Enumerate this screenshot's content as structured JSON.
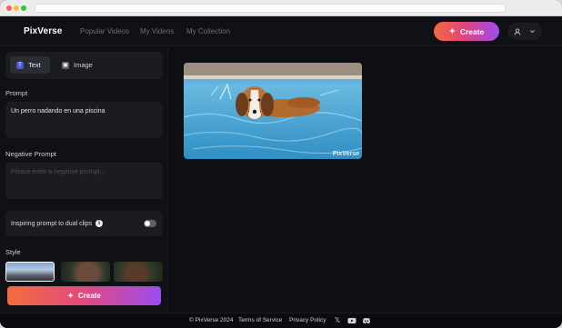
{
  "app": {
    "logo": "PixVerse"
  },
  "nav": [
    "Popular Videos",
    "My Videos",
    "My Collection"
  ],
  "header": {
    "create_label": "Create"
  },
  "mode_tabs": [
    {
      "label": "Text",
      "icon": "T"
    },
    {
      "label": "Image",
      "icon": "▣"
    }
  ],
  "prompt": {
    "label": "Prompt",
    "value": "Un perro nadando en una piscina"
  },
  "negative_prompt": {
    "label": "Negative Prompt",
    "placeholder": "Please enter a negative prompt..."
  },
  "inspire": {
    "label": "Inspiring prompt to dual clips",
    "enabled": false
  },
  "style": {
    "label": "Style"
  },
  "create_button": {
    "label": "Create"
  },
  "video": {
    "watermark": "PixVerse"
  },
  "footer": {
    "copyright": "© PixVerse 2024",
    "terms": "Terms of Service",
    "privacy": "Privacy Policy"
  },
  "colors": {
    "brand_gradient": [
      "#f46a3a",
      "#e0457c",
      "#9b4cf0"
    ],
    "background": "#0e0f12",
    "panel": "#1b1c22"
  }
}
